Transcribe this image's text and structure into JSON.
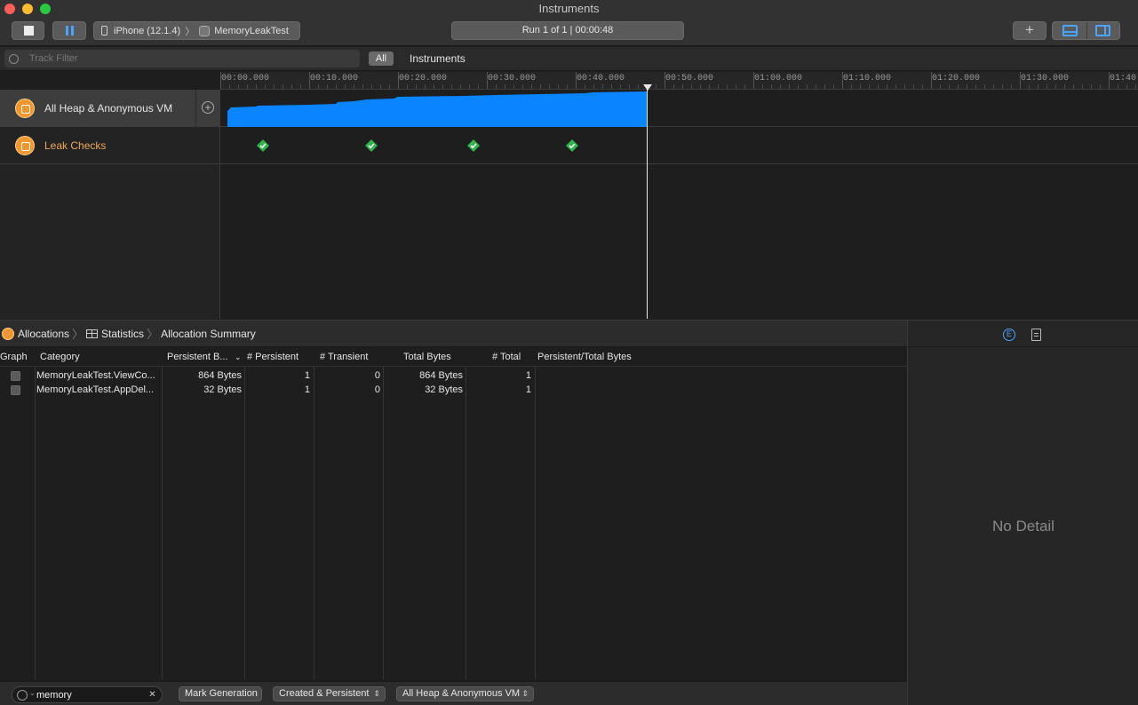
{
  "window": {
    "title": "Instruments"
  },
  "toolbar": {
    "device": "iPhone (12.1.4)",
    "target_app": "MemoryLeakTest",
    "run_status": "Run 1 of 1  |  00:00:48",
    "add_label": "+"
  },
  "filter": {
    "placeholder": "Track Filter",
    "all_label": "All",
    "instruments_label": "Instruments"
  },
  "ruler": {
    "ticks": [
      "00:00.000",
      "00:10.000",
      "00:20.000",
      "00:30.000",
      "00:40.000",
      "00:50.000",
      "01:00.000",
      "01:10.000",
      "01:20.000",
      "01:30.000",
      "01:40.0"
    ]
  },
  "tracks": [
    {
      "name": "All Heap & Anonymous VM",
      "icon": "allocations-icon"
    },
    {
      "name": "Leak Checks",
      "icon": "leaks-icon",
      "checks_at_seconds": [
        4.8,
        17.0,
        28.5,
        39.6
      ]
    }
  ],
  "breadcrumb": {
    "instrument": "Allocations",
    "view": "Statistics",
    "detail": "Allocation Summary"
  },
  "table": {
    "headers": {
      "graph": "Graph",
      "category": "Category",
      "persistent_bytes": "Persistent B...",
      "persistent": "# Persistent",
      "transient": "# Transient",
      "total_bytes": "Total Bytes",
      "total": "# Total",
      "ratio": "Persistent/Total Bytes"
    },
    "rows": [
      {
        "category": "MemoryLeakTest.ViewCo...",
        "persistent_bytes": "864 Bytes",
        "persistent": "1",
        "transient": "0",
        "total_bytes": "864 Bytes",
        "total": "1"
      },
      {
        "category": "MemoryLeakTest.AppDel...",
        "persistent_bytes": "32 Bytes",
        "persistent": "1",
        "transient": "0",
        "total_bytes": "32 Bytes",
        "total": "1"
      }
    ]
  },
  "bottom_bar": {
    "search_value": "memory",
    "mark_generation": "Mark Generation",
    "lifespan": "Created & Persistent",
    "allocation_type": "All Heap & Anonymous VM"
  },
  "side_panel": {
    "empty_text": "No Detail"
  },
  "colors": {
    "graph_fill": "#0a84ff",
    "check_green": "#2fb44a",
    "accent": "#4aa3ff"
  }
}
